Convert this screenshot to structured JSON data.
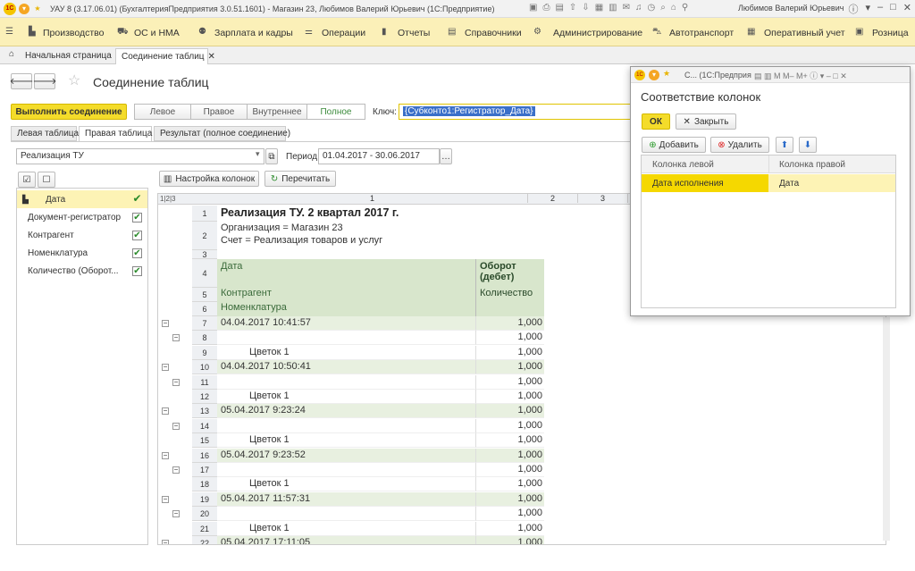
{
  "titlebar": {
    "text": "УАУ 8 (3.17.06.01) (БухгалтерияПредприятия 3.0.51.1601) - Магазин 23, Любимов Валерий Юрьевич (1С:Предприятие)",
    "user": "Любимов Валерий Юрьевич",
    "logo": "1С"
  },
  "menu": [
    "Производство",
    "ОС и НМА",
    "Зарплата и кадры",
    "Операции",
    "Отчеты",
    "Справочники",
    "Администрирование",
    "Автотранспорт",
    "Оперативный учет",
    "Розница"
  ],
  "tabs": {
    "home": "Начальная страница",
    "current": "Соединение таблиц"
  },
  "form": {
    "title": "Соединение таблиц",
    "execute": "Выполнить соединение",
    "join_types": [
      "Левое",
      "Правое",
      "Внутреннее",
      "Полное"
    ],
    "key_label": "Ключ:",
    "key_value": "{Субконто1:Регистратор_Дата}",
    "subtabs": [
      "Левая таблица",
      "Правая таблица",
      "Результат (полное соединение)"
    ],
    "report_select": "Реализация ТУ",
    "period_label": "Период:",
    "period_value": "01.04.2017 - 30.06.2017",
    "col_settings": "Настройка колонок",
    "recalc": "Перечитать",
    "level_buttons": "1|2|3"
  },
  "fields": [
    {
      "label": "Дата",
      "checked": true,
      "selected": true
    },
    {
      "label": "Документ-регистратор",
      "checked": true
    },
    {
      "label": "Контрагент",
      "checked": true
    },
    {
      "label": "Номенклатура",
      "checked": true
    },
    {
      "label": "Количество (Оборот...",
      "checked": true
    }
  ],
  "sheet": {
    "col_headers": [
      "1",
      "2",
      "3"
    ],
    "title": "Реализация ТУ. 2 квартал 2017 г.",
    "org": "Организация = Магазин 23",
    "account": "Счет = Реализация товаров и услуг",
    "h_date": "Дата",
    "h_turnover": "Оборот (дебет)",
    "h_contractor": "Контрагент",
    "h_qty": "Количество",
    "h_item": "Номенклатура",
    "rows": [
      {
        "n": "7",
        "text": "04.04.2017 10:41:57",
        "val": "1,000",
        "type": "date"
      },
      {
        "n": "8",
        "text": "",
        "val": "1,000",
        "type": "blank"
      },
      {
        "n": "9",
        "text": "Цветок 1",
        "val": "1,000",
        "type": "item"
      },
      {
        "n": "10",
        "text": "04.04.2017 10:50:41",
        "val": "1,000",
        "type": "date"
      },
      {
        "n": "11",
        "text": "",
        "val": "1,000",
        "type": "blank"
      },
      {
        "n": "12",
        "text": "Цветок 1",
        "val": "1,000",
        "type": "item"
      },
      {
        "n": "13",
        "text": "05.04.2017 9:23:24",
        "val": "1,000",
        "type": "date"
      },
      {
        "n": "14",
        "text": "",
        "val": "1,000",
        "type": "blank"
      },
      {
        "n": "15",
        "text": "Цветок 1",
        "val": "1,000",
        "type": "item"
      },
      {
        "n": "16",
        "text": "05.04.2017 9:23:52",
        "val": "1,000",
        "type": "date"
      },
      {
        "n": "17",
        "text": "",
        "val": "1,000",
        "type": "blank"
      },
      {
        "n": "18",
        "text": "Цветок 1",
        "val": "1,000",
        "type": "item"
      },
      {
        "n": "19",
        "text": "05.04.2017 11:57:31",
        "val": "1,000",
        "type": "date"
      },
      {
        "n": "20",
        "text": "",
        "val": "1,000",
        "type": "blank"
      },
      {
        "n": "21",
        "text": "Цветок 1",
        "val": "1,000",
        "type": "item"
      },
      {
        "n": "22",
        "text": "05.04.2017 17:11:05",
        "val": "1,000",
        "type": "date"
      }
    ]
  },
  "dialog": {
    "titlebar_text": "С... (1С:Предприя",
    "title": "Соответствие колонок",
    "ok": "ОК",
    "close": "Закрыть",
    "add": "Добавить",
    "delete": "Удалить",
    "col_left": "Колонка левой",
    "col_right": "Колонка правой",
    "mapping": [
      {
        "left": "Дата исполнения",
        "right": "Дата"
      }
    ]
  },
  "colors": {
    "menu_bg": "#fbf0b8",
    "accent": "#f4dc2a",
    "green_row": "#e8f0e0",
    "selection": "#f5d800"
  }
}
